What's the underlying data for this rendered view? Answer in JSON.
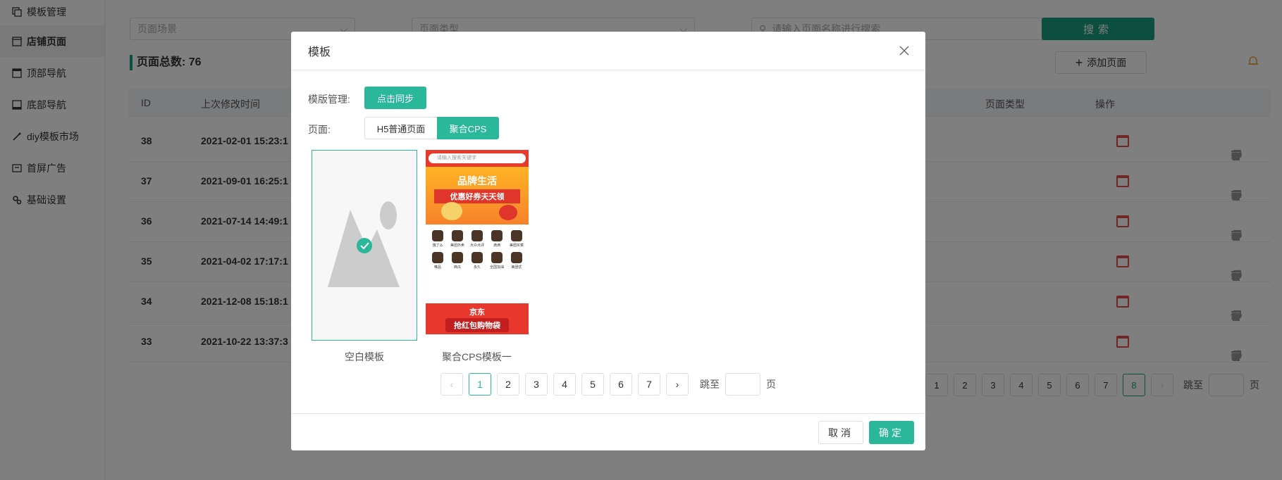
{
  "sidebar": {
    "items": [
      {
        "label": "模板管理",
        "icon": "template-icon"
      },
      {
        "label": "店铺页面",
        "icon": "page-icon",
        "active": true
      },
      {
        "label": "顶部导航",
        "icon": "top-nav-icon"
      },
      {
        "label": "底部导航",
        "icon": "bottom-nav-icon"
      },
      {
        "label": "diy模板市场",
        "icon": "wand-icon"
      },
      {
        "label": "首屏广告",
        "icon": "ad-icon"
      },
      {
        "label": "基础设置",
        "icon": "gear-icon"
      }
    ]
  },
  "filters": {
    "scene_placeholder": "页面场景",
    "type_placeholder": "页面类型",
    "search_placeholder": "请输入页面名称进行搜索",
    "search_label": "搜索"
  },
  "summary": {
    "total_label": "页面总数: 76",
    "add_label": "添加页面"
  },
  "table": {
    "headers": {
      "id": "ID",
      "modified": "上次修改时间",
      "page_type": "页面类型",
      "ops": "操作"
    },
    "rows": [
      {
        "id": "38",
        "modified": "2021-02-01 15:23:1"
      },
      {
        "id": "37",
        "modified": "2021-09-01 16:25:1"
      },
      {
        "id": "36",
        "modified": "2021-07-14 14:49:1"
      },
      {
        "id": "35",
        "modified": "2021-04-02 17:17:1"
      },
      {
        "id": "34",
        "modified": "2021-12-08 15:18:1"
      },
      {
        "id": "33",
        "modified": "2021-10-22 13:37:3"
      }
    ]
  },
  "bg_pager": {
    "pages": [
      "1",
      "2",
      "3",
      "4",
      "5",
      "6",
      "7",
      "8"
    ],
    "current": "8",
    "jump_label": "跳至",
    "page_suffix": "页"
  },
  "modal": {
    "title": "模板",
    "template_mgmt_label": "模版管理:",
    "sync_label": "点击同步",
    "page_label": "页面:",
    "tab_h5": "H5普通页面",
    "tab_cps": "聚合CPS",
    "templates": [
      {
        "caption": "空白模板"
      },
      {
        "caption": "聚合CPS模板一"
      }
    ],
    "cps_preview": {
      "search_text": "请输入搜索关键字",
      "banner_text_1": "品牌生活",
      "banner_text_2": "优惠好券天天领",
      "grid_row_1": [
        "饿了么",
        "美团外卖",
        "大众点评",
        "滴滴",
        "美团买菜"
      ],
      "grid_row_2": [
        "唯品",
        "西瓜",
        "永久",
        "全国加油",
        "美团优"
      ],
      "bottom_banner_1": "京东",
      "bottom_banner_2": "抢红包购物袋"
    },
    "pager": {
      "pages": [
        "1",
        "2",
        "3",
        "4",
        "5",
        "6",
        "7"
      ],
      "current": "1",
      "jump_label": "跳至",
      "page_suffix": "页"
    },
    "cancel_label": "取消",
    "ok_label": "确定"
  },
  "colors": {
    "accent": "#2bb89a",
    "dark_accent": "#1b9e7f",
    "danger": "#e34a4a"
  }
}
